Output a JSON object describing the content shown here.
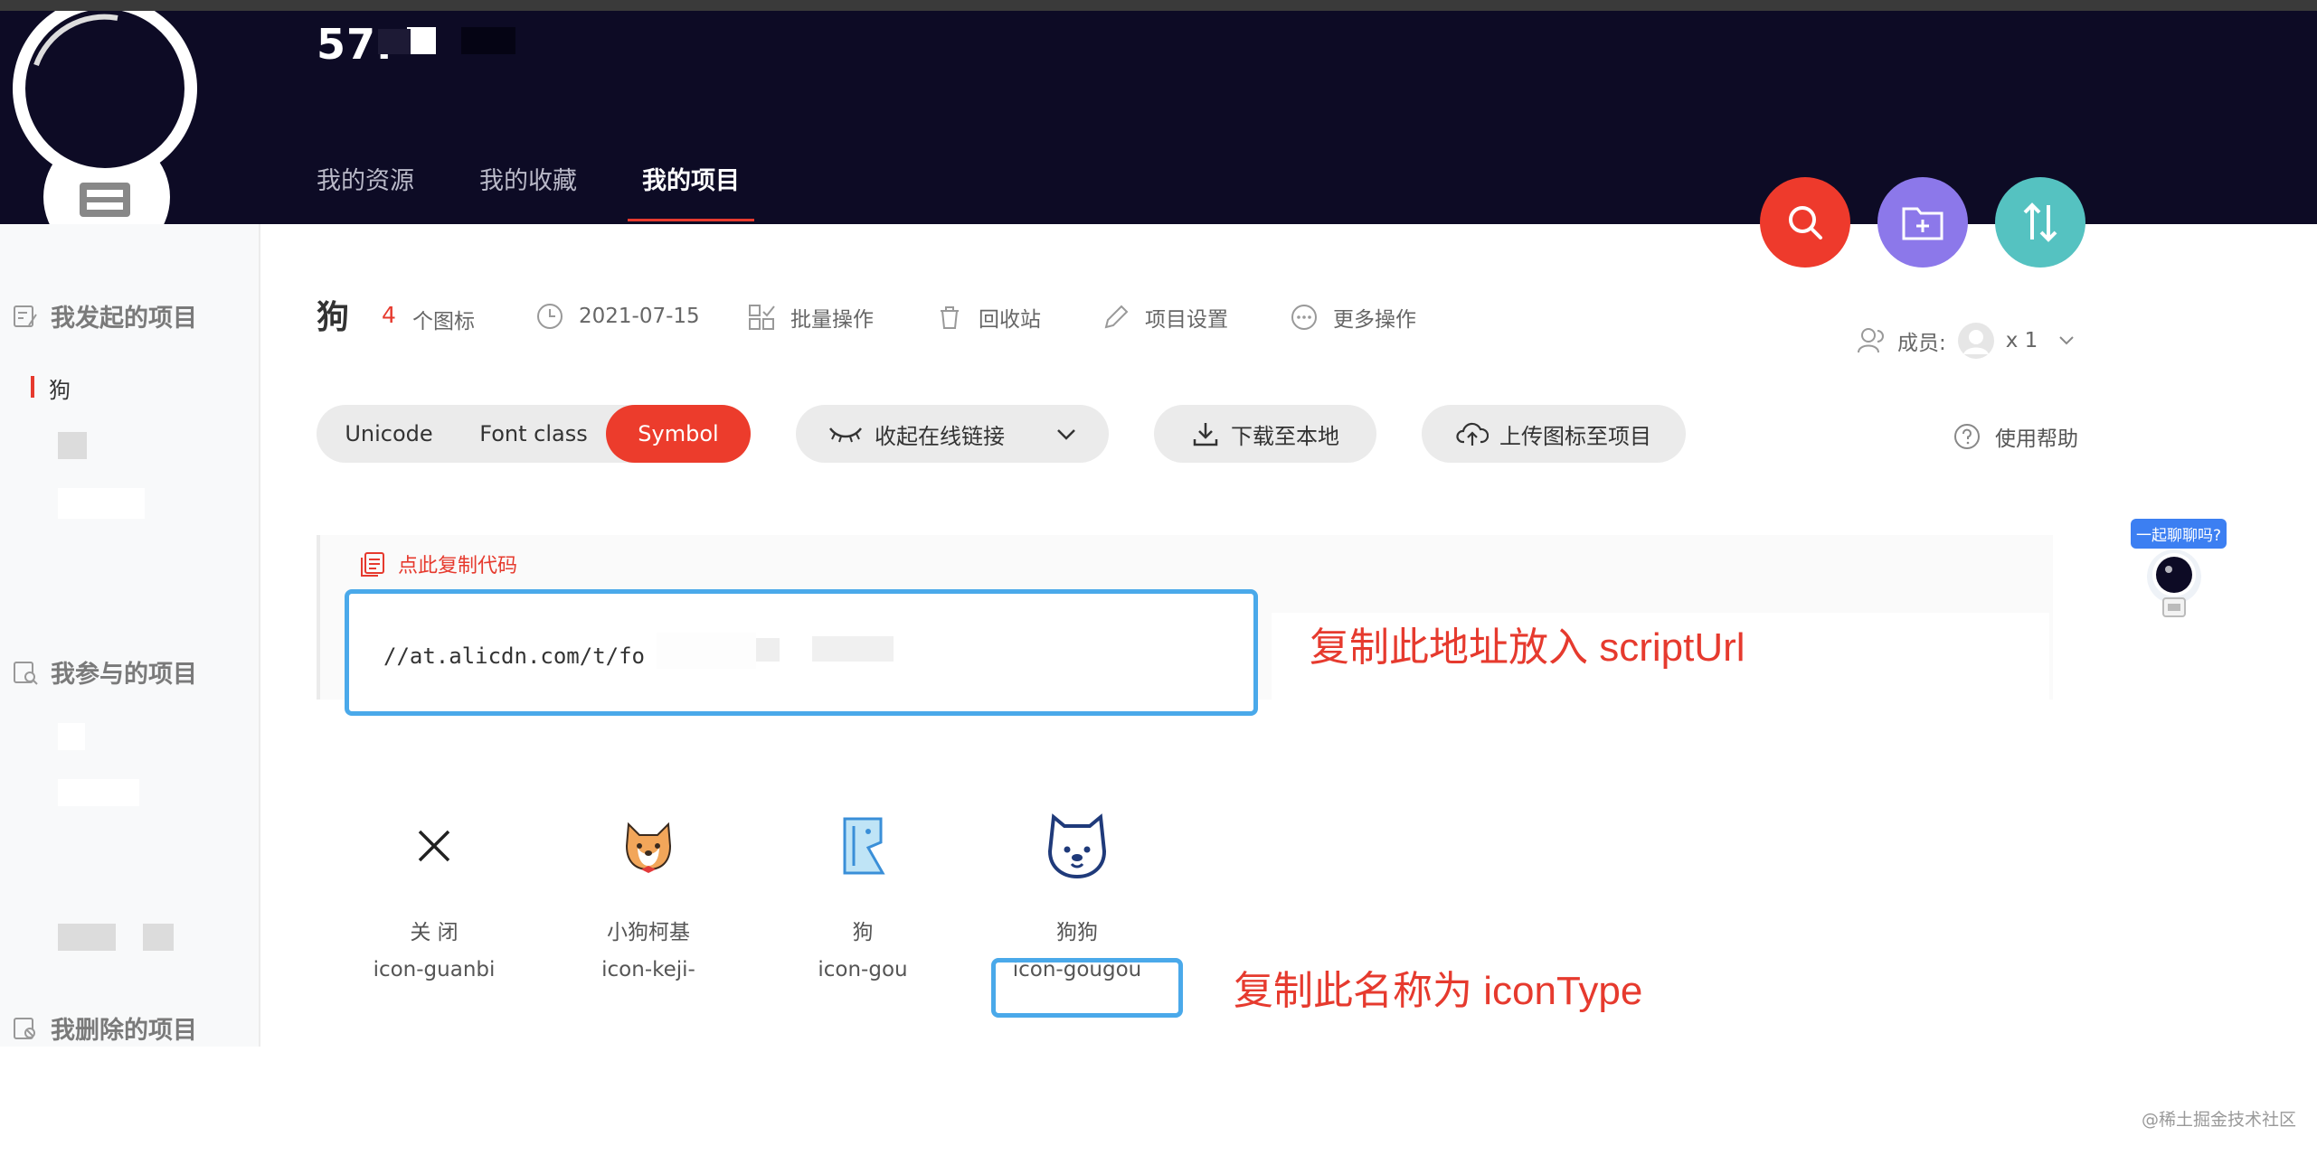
{
  "header": {
    "username": "57.",
    "tabs": [
      {
        "label": "我的资源"
      },
      {
        "label": "我的收藏"
      },
      {
        "label": "我的项目"
      }
    ]
  },
  "sidebar": {
    "started_heading": "我发起的项目",
    "active_project": "狗",
    "joined_heading": "我参与的项目",
    "deleted_heading": "我删除的项目"
  },
  "project": {
    "title": "狗",
    "icon_count": "4",
    "icon_count_label": "个图标",
    "date": "2021-07-15",
    "batch_label": "批量操作",
    "recycle_label": "回收站",
    "settings_label": "项目设置",
    "more_label": "更多操作",
    "members_label": "成员:",
    "members_count": "x 1"
  },
  "toolbar": {
    "modes": [
      "Unicode",
      "Font class",
      "Symbol"
    ],
    "active_mode": "Symbol",
    "collapse_label": "收起在线链接",
    "download_label": "下载至本地",
    "upload_label": "上传图标至项目",
    "help_label": "使用帮助"
  },
  "code": {
    "copy_label": "点此复制代码",
    "url": "//at.alicdn.com/t/fo"
  },
  "annotations": {
    "url_note": "复制此地址放入 scriptUrl",
    "name_note": "复制此名称为 iconType"
  },
  "icons": [
    {
      "name": "关 闭",
      "code": "icon-guanbi",
      "icon": "close-icon"
    },
    {
      "name": "小狗柯基",
      "code": "icon-keji-",
      "icon": "corgi-icon"
    },
    {
      "name": "狗",
      "code": "icon-gou",
      "icon": "dog-outline-icon"
    },
    {
      "name": "狗狗",
      "code": "icon-gougou",
      "icon": "dog-face-icon"
    }
  ],
  "chat_bubble": "一起聊聊吗?",
  "watermark": "@稀土掘金技术社区",
  "colors": {
    "header_bg": "#0d0b25",
    "accent_red": "#e63a2e",
    "highlight_blue": "#4aa9ea",
    "fab_purple": "#8c78ea",
    "fab_teal": "#55c2c1"
  }
}
